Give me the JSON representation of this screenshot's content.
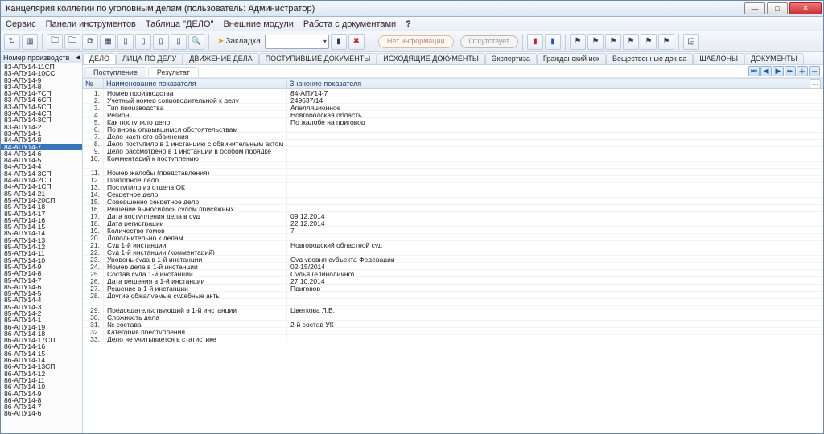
{
  "window": {
    "title": "Канцелярия коллегии по уголовным делам (пользователь: Администратор)"
  },
  "menu": {
    "service": "Сервис",
    "toolbars": "Панели инструментов",
    "table": "Таблица \"ДЕЛО\"",
    "external": "Внешние модули",
    "docs": "Работа с документами",
    "help": "?"
  },
  "toolbar": {
    "bookmark_label": "Закладка",
    "pill1": "Нет информации",
    "pill2": "Отсутствует"
  },
  "sidebar": {
    "header": "Номер производств",
    "items": [
      "83-АПУ14-11СП",
      "83-АПУ14-10СС",
      "83-АПУ14-9",
      "83-АПУ14-8",
      "83-АПУ14-7СП",
      "83-АПУ14-6СП",
      "83-АПУ14-5СП",
      "83-АПУ14-4СП",
      "83-АПУ14-3СП",
      "83-АПУ14-2",
      "83-АПУ14-1",
      "84-АПУ14-8",
      "84-АПУ14-7",
      "84-АПУ14-6",
      "84-АПУ14-5",
      "84-АПУ14-4",
      "84-АПУ14-3СП",
      "84-АПУ14-2СП",
      "84-АПУ14-1СП",
      "85-АПУ14-21",
      "85-АПУ14-20СП",
      "85-АПУ14-18",
      "85-АПУ14-17",
      "85-АПУ14-16",
      "85-АПУ14-15",
      "85-АПУ14-14",
      "85-АПУ14-13",
      "85-АПУ14-12",
      "85-АПУ14-11",
      "85-АПУ14-10",
      "85-АПУ14-9",
      "85-АПУ14-8",
      "85-АПУ14-7",
      "85-АПУ14-6",
      "85-АПУ14-5",
      "85-АПУ14-4",
      "85-АПУ14-3",
      "85-АПУ14-2",
      "85-АПУ14-1",
      "86-АПУ14-19",
      "86-АПУ14-18",
      "86-АПУ14-17СП",
      "86-АПУ14-16",
      "86-АПУ14-15",
      "86-АПУ14-14",
      "86-АПУ14-13СП",
      "86-АПУ14-12",
      "86-АПУ14-11",
      "86-АПУ14-10",
      "86-АПУ14-9",
      "86-АПУ14-8",
      "86-АПУ14-7",
      "86-АПУ14-6"
    ],
    "selected_index": 12
  },
  "tabs": [
    "ДЕЛО",
    "ЛИЦА ПО ДЕЛУ",
    "ДВИЖЕНИЕ ДЕЛА",
    "ПОСТУПИВШИЕ ДОКУМЕНТЫ",
    "ИСХОДЯЩИЕ ДОКУМЕНТЫ",
    "Экспертиза",
    "Гражданский иск",
    "Вещественные док-ва",
    "ШАБЛОНЫ",
    "ДОКУМЕНТЫ"
  ],
  "subtabs": {
    "a": "Поступление",
    "b": "Результат"
  },
  "grid": {
    "col_num": "№",
    "col_name": "Наименование показателя",
    "col_val": "Значение показателя",
    "rows": [
      {
        "n": "1.",
        "name": "Номер производства",
        "val": "84-АПУ14-7"
      },
      {
        "n": "2.",
        "name": "Учетный номер сопроводительной к делу",
        "val": "249637/14"
      },
      {
        "n": "3.",
        "name": "Тип производства",
        "val": "Апелляционное"
      },
      {
        "n": "4.",
        "name": "Регион",
        "val": "Новгородская область"
      },
      {
        "n": "5.",
        "name": "Как поступило дело",
        "val": "По жалобе на приговор"
      },
      {
        "n": "6.",
        "name": "По вновь открывшимся обстоятельствам",
        "val": ""
      },
      {
        "n": "7.",
        "name": "Дело частного обвинения",
        "val": ""
      },
      {
        "n": "8.",
        "name": "Дело поступило в 1 инстанцию с обвинительным актом",
        "val": ""
      },
      {
        "n": "9.",
        "name": "Дело рассмотрено в 1 инстанции в особом порядке",
        "val": ""
      },
      {
        "n": "10.",
        "name": "Комментарий к поступлению",
        "val": ""
      },
      {
        "n": "",
        "name": "",
        "val": ""
      },
      {
        "n": "11.",
        "name": "Номер жалобы (представления)",
        "val": ""
      },
      {
        "n": "12.",
        "name": "Повторное дело",
        "val": ""
      },
      {
        "n": "13.",
        "name": "Поступило из отдела ОК",
        "val": ""
      },
      {
        "n": "14.",
        "name": "Секретное дело",
        "val": ""
      },
      {
        "n": "15.",
        "name": "Совершенно секретное дело",
        "val": ""
      },
      {
        "n": "16.",
        "name": "Решение выносилось судом присяжных",
        "val": ""
      },
      {
        "n": "17.",
        "name": "Дата поступления дела в суд",
        "val": "09.12.2014"
      },
      {
        "n": "18.",
        "name": "Дата регистрации",
        "val": "22.12.2014"
      },
      {
        "n": "19.",
        "name": "Количество томов",
        "val": "7"
      },
      {
        "n": "20.",
        "name": "Дополнительно к делам",
        "val": ""
      },
      {
        "n": "21.",
        "name": "Суд 1-й инстанции",
        "val": "Новгородский областной суд"
      },
      {
        "n": "22.",
        "name": "Суд 1-й инстанции (комментарий)",
        "val": ""
      },
      {
        "n": "23.",
        "name": "Уровень суда в 1-й инстанции",
        "val": "Суд уровня субъекта Федерации"
      },
      {
        "n": "24.",
        "name": "Номер дела в 1-й инстанции",
        "val": "02-15/2014"
      },
      {
        "n": "25.",
        "name": "Состав суда 1-й инстанции",
        "val": "Судья (единолично)"
      },
      {
        "n": "26.",
        "name": "Дата решения в 1-й инстанции",
        "val": "27.10.2014"
      },
      {
        "n": "27.",
        "name": "Решение в 1-й инстанции",
        "val": "Приговор"
      },
      {
        "n": "28.",
        "name": "Другие обжалуемые судебные акты",
        "val": ""
      },
      {
        "n": "",
        "name": "",
        "val": ""
      },
      {
        "n": "29.",
        "name": "Председательствующий в 1-й инстанции",
        "val": "Цветкова Л.В."
      },
      {
        "n": "30.",
        "name": "Сложность дела",
        "val": ""
      },
      {
        "n": "31.",
        "name": "№ состава",
        "val": "2-й состав УК"
      },
      {
        "n": "32.",
        "name": "Категория преступления",
        "val": ""
      },
      {
        "n": "33.",
        "name": "Дело не учитывается в статистике",
        "val": ""
      }
    ]
  }
}
